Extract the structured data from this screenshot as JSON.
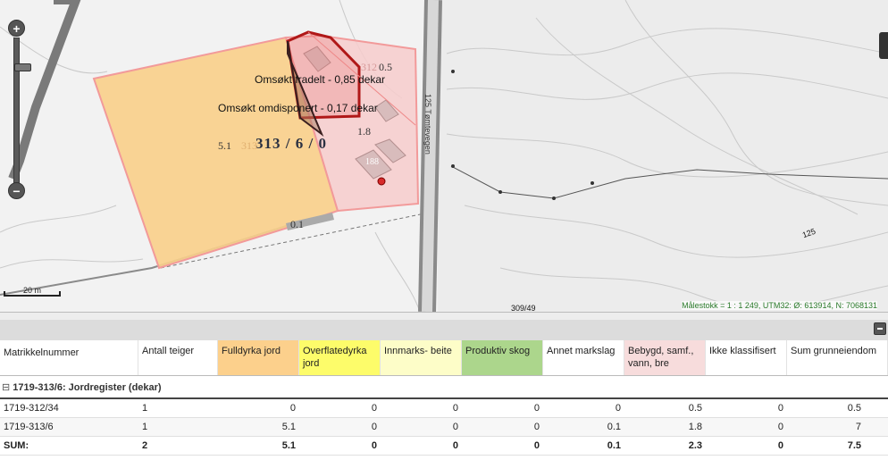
{
  "map": {
    "labels": {
      "fradelt": "Omsøkt fradelt - 0,85 dekar",
      "omdisponert": "Omsøkt omdisponert - 0,17 dekar",
      "parcel": "313 / 6 / 0",
      "num_312": "312",
      "num_05": "0.5",
      "num_18": "1.8",
      "num_51": "5.1",
      "num_313": "313",
      "num_01": "0.1",
      "num_188": "188",
      "road": "125 Tømtevegen",
      "contour_125": "125",
      "parcel_309": "309/49"
    },
    "scale_label": "20 m",
    "status": "Målestokk = 1 : 1 249, UTM32: Ø: 613914, N: 7068131",
    "zoom_in": "+",
    "zoom_out": "−"
  },
  "table": {
    "headers": [
      {
        "label": "Matrikkelnummer",
        "color": "#ffffff"
      },
      {
        "label": "Antall teiger",
        "color": "#ffffff"
      },
      {
        "label": "Fulldyrka jord",
        "color": "#fcd08c"
      },
      {
        "label": "Overflatedyrka jord",
        "color": "#fdfc6a"
      },
      {
        "label": "Innmarks- beite",
        "color": "#fdfdc8"
      },
      {
        "label": "Produktiv skog",
        "color": "#acd68c"
      },
      {
        "label": "Annet markslag",
        "color": "#ffffff"
      },
      {
        "label": "Bebygd, samf., vann, bre",
        "color": "#f7dcdc"
      },
      {
        "label": "Ikke klassifisert",
        "color": "#ffffff"
      },
      {
        "label": "Sum grunneiendom",
        "color": "#ffffff"
      }
    ],
    "group_label": "1719-313/6: Jordregister (dekar)",
    "rows": [
      [
        "1719-312/34",
        "1",
        "0",
        "0",
        "0",
        "0",
        "0",
        "0.5",
        "0",
        "0.5"
      ],
      [
        "1719-313/6",
        "1",
        "5.1",
        "0",
        "0",
        "0",
        "0.1",
        "1.8",
        "0",
        "7"
      ]
    ],
    "sum": [
      "SUM:",
      "2",
      "5.1",
      "0",
      "0",
      "0",
      "0.1",
      "2.3",
      "0",
      "7.5"
    ]
  }
}
